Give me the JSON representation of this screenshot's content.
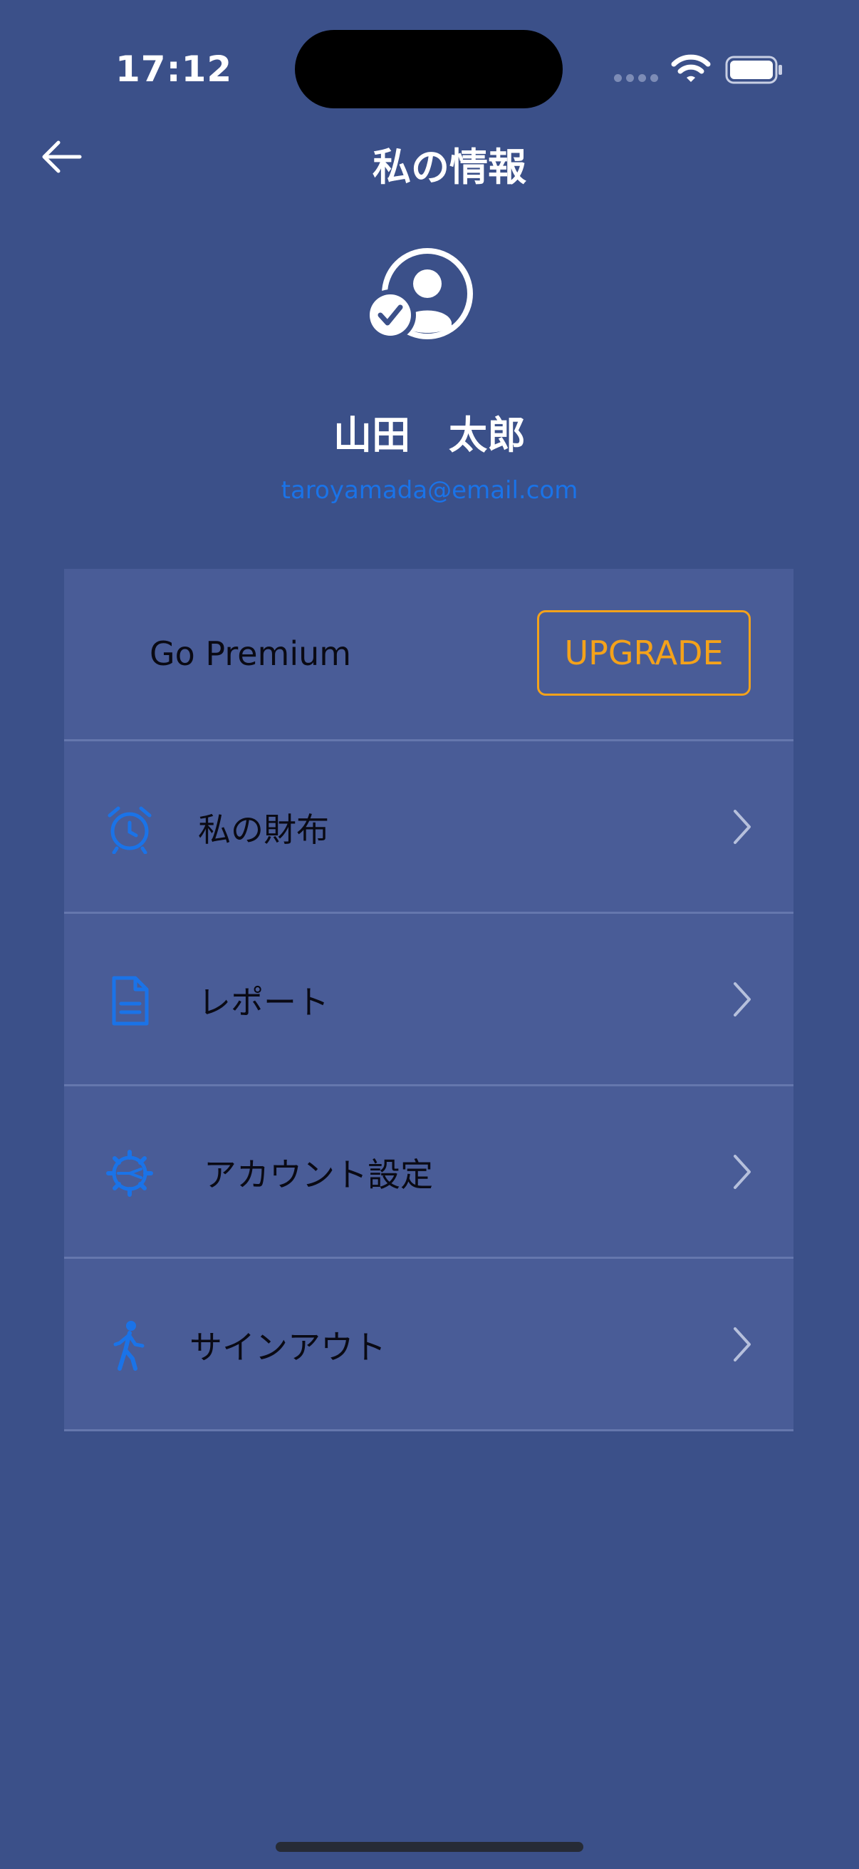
{
  "status_bar": {
    "time": "17:12"
  },
  "header": {
    "title": "私の情報",
    "back_icon": "arrow-left-icon"
  },
  "profile": {
    "avatar_icon": "verified-user-circle-icon",
    "name": "山田　太郎",
    "email": "taroyamada@email.com"
  },
  "premium": {
    "label": "Go Premium",
    "button_label": "UPGRADE"
  },
  "menu": {
    "items": [
      {
        "label": "私の財布",
        "icon": "alarm-clock-icon"
      },
      {
        "label": "レポート",
        "icon": "document-icon"
      },
      {
        "label": "アカウント設定",
        "icon": "settings-gear-icon"
      },
      {
        "label": "サインアウト",
        "icon": "walking-person-icon"
      }
    ]
  },
  "colors": {
    "background": "#3b5089",
    "card": "#495c97",
    "accent_blue": "#1a73e8",
    "upgrade_orange": "#f4a21a"
  }
}
